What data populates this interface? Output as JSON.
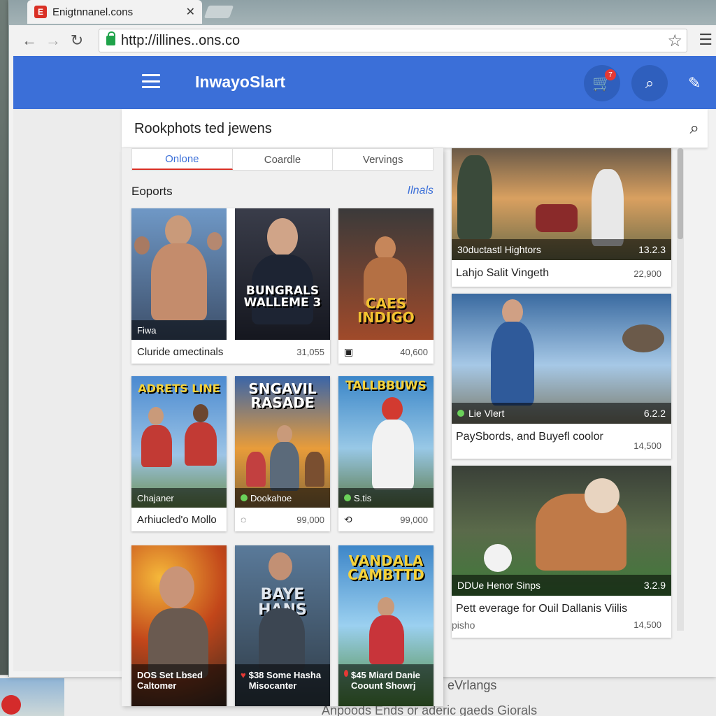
{
  "browser": {
    "tab_title": "Enigtnnanel.cons",
    "url": "http://illines..ons.co"
  },
  "app": {
    "title": "InwayoSlart",
    "notification_count": "7",
    "search_query": "Rookphots ted jewens"
  },
  "tabs": [
    {
      "label": "Onlone",
      "active": true
    },
    {
      "label": "Coardle",
      "active": false
    },
    {
      "label": "Vervings",
      "active": false
    }
  ],
  "section": {
    "title": "Eoports",
    "link": "Ilnals"
  },
  "grid": [
    {
      "poster": "",
      "overlay": "Fiwa",
      "caption": "Cluride ɑmectinals",
      "value": "31,055",
      "wide": true
    },
    {
      "poster": "BUNGRALS WALLEME 3",
      "overlay": "",
      "caption": "",
      "value": "",
      "hidden_meta": true
    },
    {
      "poster": "CAES INDIGO",
      "overlay": "",
      "caption": "",
      "value": "40,600",
      "icon": "save-icon"
    },
    {
      "poster": "ADRETS LINE",
      "overlay": "Chajaner",
      "caption": "Arhiucled'o Mollo",
      "value": "",
      "wide": true
    },
    {
      "poster": "SNGAVIL RASADE",
      "overlay": "Dookahoe",
      "caption": "",
      "value": "99,000",
      "icon": "bulb-icon",
      "hidden_meta": false
    },
    {
      "poster": "TALLBBUWS",
      "overlay": "S.tis",
      "caption": "",
      "value": "99,000",
      "icon": "refresh-icon"
    },
    {
      "poster": "",
      "overlay": "DOS Set Lbsed Caltomer",
      "caption": "",
      "value": ""
    },
    {
      "poster": "BAYE HANS",
      "overlay": "$38 Some Hasha Misocanter",
      "caption": "",
      "value": ""
    },
    {
      "poster": "VANDALA CAMBTTD",
      "overlay": "$45 Miard Danie Coount Showrj",
      "caption": "",
      "value": ""
    }
  ],
  "right": [
    {
      "bar_left": "30ductastl Hightors",
      "bar_right": "13.2.3",
      "caption": "Lahjo Salit Vingeth",
      "value": "22,900"
    },
    {
      "bar_left": "Lie Vlert",
      "bar_right": "6.2.2",
      "caption": "PaySbords, and Buyefl coolor",
      "value": "14,500"
    },
    {
      "bar_left": "DDUe Henor Sinps",
      "bar_right": "3.2.9",
      "caption": "Pett everage for Ouil Dallanis Viilis",
      "sub": "pisho",
      "value": "14,500"
    }
  ],
  "back_window": {
    "caption": "eVrlangs",
    "caption2": "Anpoods Ends  or  aderic gaeds  Giorals",
    "edge_1": "90",
    "edge_2": "ES"
  },
  "colors": {
    "appbar": "#3b6fd8",
    "accent_red": "#d93025"
  }
}
